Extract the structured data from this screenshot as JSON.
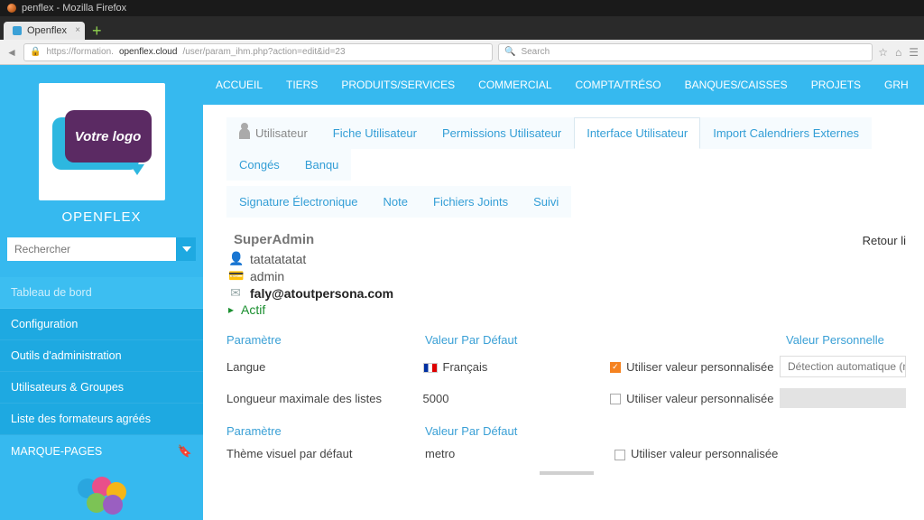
{
  "os": {
    "title": "penflex - Mozilla Firefox"
  },
  "browser": {
    "tab_label": "Openflex",
    "url_host": "openflex.cloud",
    "url_prefix": "https://formation.",
    "url_path": "/user/param_ihm.php?action=edit&id=23",
    "search_placeholder": "Search"
  },
  "sidebar": {
    "brand": "OPENFLEX",
    "logo_text": "Votre logo",
    "search_placeholder": "Rechercher",
    "items": [
      "Tableau de bord",
      "Configuration",
      "Outils d'administration",
      "Utilisateurs & Groupes",
      "Liste des formateurs agréés",
      "MARQUE-PAGES"
    ]
  },
  "topnav": [
    "ACCUEIL",
    "TIERS",
    "PRODUITS/SERVICES",
    "COMMERCIAL",
    "COMPTA/TRÉSO",
    "BANQUES/CAISSES",
    "PROJETS",
    "GRH"
  ],
  "subtabs_row1": [
    "Utilisateur",
    "Fiche Utilisateur",
    "Permissions Utilisateur",
    "Interface Utilisateur",
    "Import Calendriers Externes",
    "Congés",
    "Banqu"
  ],
  "subtabs_row2": [
    "Signature Électronique",
    "Note",
    "Fichiers Joints",
    "Suivi"
  ],
  "active_subtab": "Interface Utilisateur",
  "user": {
    "title": "SuperAdmin",
    "name": "tatatatatat",
    "login": "admin",
    "email": "faly@atoutpersona.com",
    "status": "Actif",
    "back_link": "Retour li"
  },
  "table1": {
    "headers": [
      "Paramètre",
      "Valeur Par Défaut",
      "",
      "Valeur Personnelle"
    ],
    "rows": [
      {
        "param": "Langue",
        "default": "Français",
        "flag": true,
        "use_label": "Utiliser valeur personnalisée",
        "checked": true,
        "personal": "Détection automatique (navi."
      },
      {
        "param": "Longueur maximale des listes",
        "default": "5000",
        "flag": false,
        "use_label": "Utiliser valeur personnalisée",
        "checked": false,
        "personal": ""
      }
    ]
  },
  "table2": {
    "headers": [
      "Paramètre",
      "Valeur Par Défaut"
    ],
    "rows": [
      {
        "param": "Thème visuel par défaut",
        "default": "metro",
        "use_label": "Utiliser valeur personnalisée",
        "checked": false
      }
    ]
  }
}
